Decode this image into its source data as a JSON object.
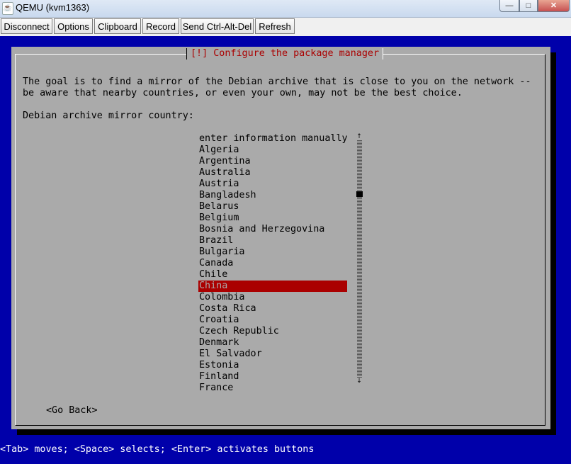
{
  "window": {
    "title": "QEMU (kvm1363)",
    "app_icon": "java-cup-icon",
    "controls": {
      "minimize": "—",
      "maximize": "□",
      "close": "✕"
    }
  },
  "toolbar": {
    "buttons": [
      "Disconnect",
      "Options",
      "Clipboard",
      "Record",
      "Send Ctrl-Alt-Del",
      "Refresh"
    ]
  },
  "installer": {
    "title": "[!] Configure the package manager",
    "description_line1": "The goal is to find a mirror of the Debian archive that is close to you on the network --",
    "description_line2": "be aware that nearby countries, or even your own, may not be the best choice.",
    "prompt": "Debian archive mirror country:",
    "countries": [
      "enter information manually",
      "Algeria",
      "Argentina",
      "Australia",
      "Austria",
      "Bangladesh",
      "Belarus",
      "Belgium",
      "Bosnia and Herzegovina",
      "Brazil",
      "Bulgaria",
      "Canada",
      "Chile",
      "China",
      "Colombia",
      "Costa Rica",
      "Croatia",
      "Czech Republic",
      "Denmark",
      "El Salvador",
      "Estonia",
      "Finland",
      "France"
    ],
    "selected": "China",
    "scroll_position": 0.22,
    "scroll_up": "↑",
    "scroll_down": "↓",
    "go_back": "<Go Back>"
  },
  "status_bar": "<Tab> moves; <Space> selects; <Enter> activates buttons",
  "colors": {
    "console_bg": "#0000aa",
    "dialog_bg": "#aaaaaa",
    "title_fg": "#aa0000",
    "selection_bg": "#aa0000"
  }
}
